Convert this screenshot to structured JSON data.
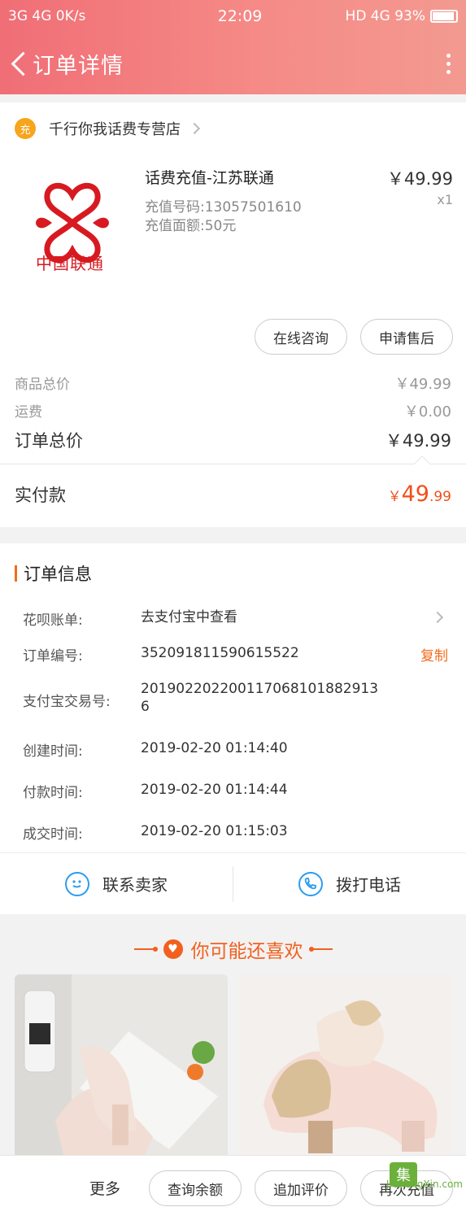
{
  "status_bar": {
    "left": "3G  4G  0K/s",
    "time": "22:09",
    "right": "HD 4G 93%"
  },
  "nav": {
    "title": "订单详情"
  },
  "store": {
    "logo_char": "充",
    "name": "千行你我话费专营店"
  },
  "product": {
    "brand_text": "中国联通",
    "title": "话费充值-江苏联通",
    "line1": "充值号码:13057501610",
    "line2": "充值面额:50元",
    "price": "￥49.99",
    "qty": "x1"
  },
  "actions": {
    "consult": "在线咨询",
    "after_sale": "申请售后"
  },
  "summary": {
    "goods_label": "商品总价",
    "goods_val": "￥49.99",
    "ship_label": "运费",
    "ship_val": "￥0.00",
    "total_label": "订单总价",
    "total_val": "￥49.99",
    "paid_label": "实付款",
    "paid_symbol": "￥",
    "paid_int": "49",
    "paid_dec": ".99"
  },
  "order_info": {
    "title": "订单信息",
    "rows": [
      {
        "label": "花呗账单:",
        "value": "去支付宝中查看"
      },
      {
        "label": "订单编号:",
        "value": "352091811590615522",
        "action": "复制"
      },
      {
        "label": "支付宝交易号:",
        "value": "20190220220011706810188291 3",
        "value_line1": "201902202200117068101882913",
        "value_line2": "6"
      },
      {
        "label": "创建时间:",
        "value": "2019-02-20 01:14:40"
      },
      {
        "label": "付款时间:",
        "value": "2019-02-20 01:14:44"
      },
      {
        "label": "成交时间:",
        "value": "2019-02-20 01:15:03"
      }
    ]
  },
  "contact": {
    "seller": "联系卖家",
    "call": "拨打电话"
  },
  "recommend": {
    "title": "你可能还喜欢"
  },
  "bottom": {
    "more": "更多",
    "balance": "查询余额",
    "review": "追加评价",
    "recharge": "再次充值",
    "watermark": "JiChengXin.com"
  },
  "colors": {
    "accent": "#f26c1e",
    "header_start": "#f06e76",
    "header_end": "#f39a90",
    "unicom_red": "#d71a21"
  }
}
